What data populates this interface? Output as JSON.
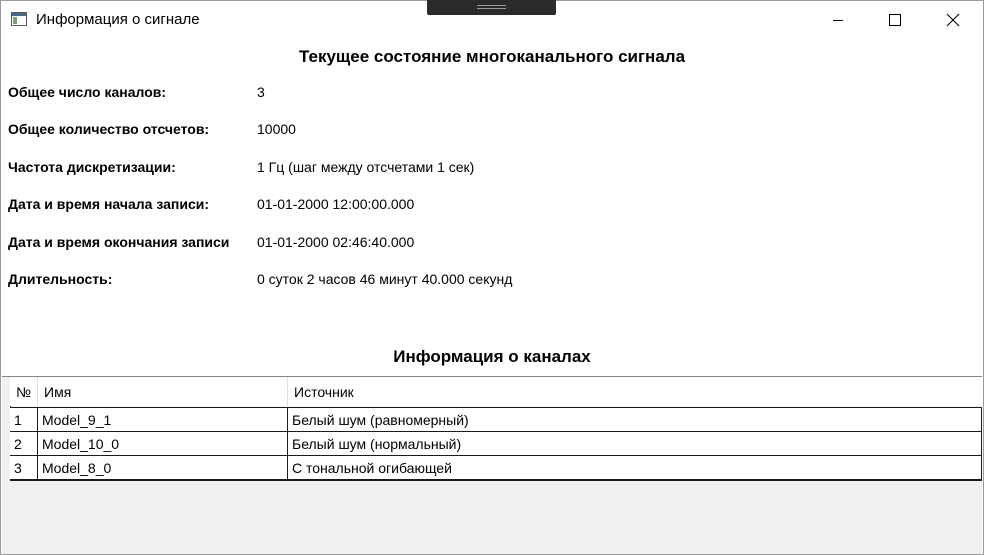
{
  "window": {
    "title": "Информация о сигнале",
    "icons": [
      "app-window-icon",
      "minimize-icon",
      "maximize-icon",
      "close-icon"
    ]
  },
  "signal": {
    "heading": "Текущее состояние многоканального сигнала",
    "fields": [
      {
        "label": "Общее число каналов:",
        "value": "3"
      },
      {
        "label": "Общее количество отсчетов:",
        "value": "10000"
      },
      {
        "label": "Частота дискретизации:",
        "value": "1 Гц (шаг между отсчетами 1 сек)"
      },
      {
        "label": "Дата и время начала записи:",
        "value": "01-01-2000 12:00:00.000"
      },
      {
        "label": "Дата и время окончания записи",
        "value": "01-01-2000 02:46:40.000"
      },
      {
        "label": "Длительность:",
        "value": "0 суток 2 часов 46 минут 40.000 секунд"
      }
    ]
  },
  "channels": {
    "heading": "Информация о каналах",
    "columns": [
      "№",
      "Имя",
      "Источник"
    ],
    "rows": [
      [
        "1",
        "Model_9_1",
        "Белый шум (равномерный)"
      ],
      [
        "2",
        "Model_10_0",
        "Белый шум (нормальный)"
      ],
      [
        "3",
        "Model_8_0",
        "С тональной огибающей"
      ]
    ]
  }
}
